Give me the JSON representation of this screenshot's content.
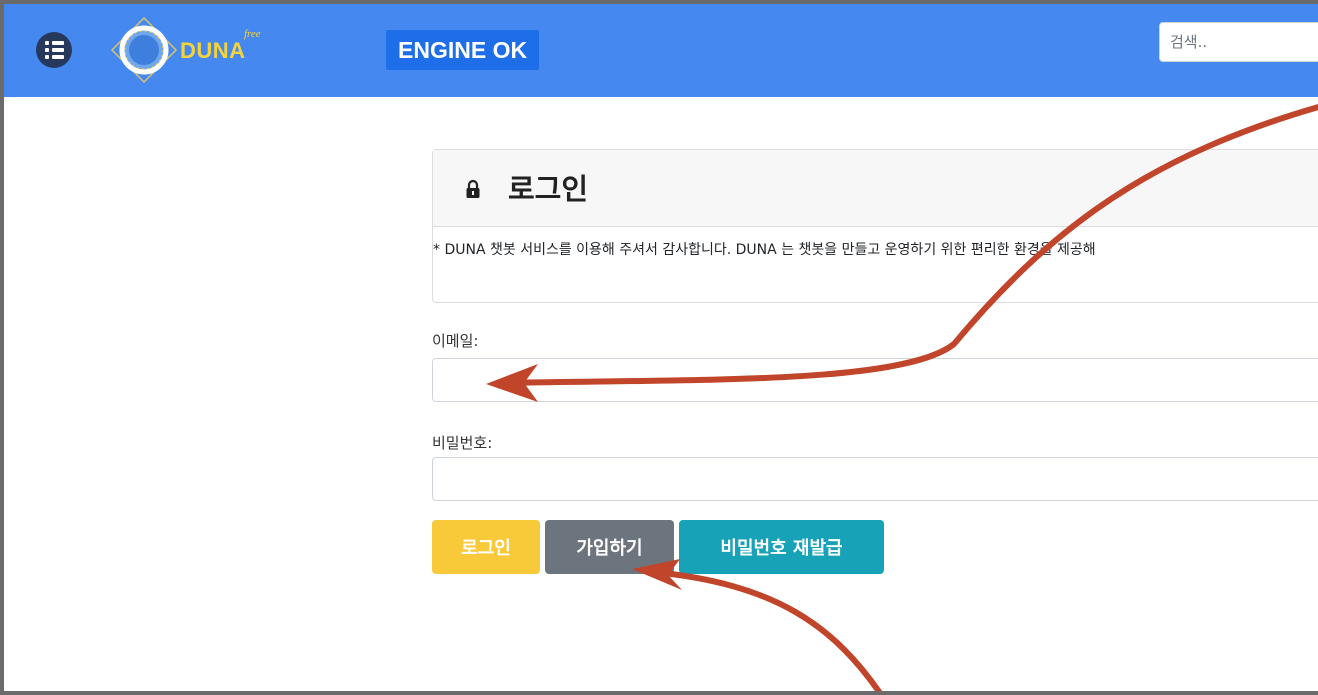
{
  "header": {
    "brand": "DUNA",
    "brand_sup": "free",
    "engine_status": "ENGINE OK",
    "search_placeholder": "검색.."
  },
  "login_card": {
    "title": "로그인",
    "notice": "* DUNA 챗봇 서비스를 이용해 주셔서 감사합니다. DUNA 는 챗봇을 만들고 운영하기 위한 편리한 환경을 제공해"
  },
  "form": {
    "email_label": "이메일:",
    "email_value": "",
    "password_label": "비밀번호:",
    "password_value": ""
  },
  "buttons": {
    "login": "로그인",
    "join": "가입하기",
    "reset_password": "비밀번호 재발급"
  },
  "colors": {
    "topbar": "#4589f0",
    "engine_badge": "#1d6ee8",
    "login_button": "#f8c938",
    "join_button": "#6c757d",
    "reset_button": "#17a2b8",
    "annotation_arrow": "#c0452a"
  }
}
